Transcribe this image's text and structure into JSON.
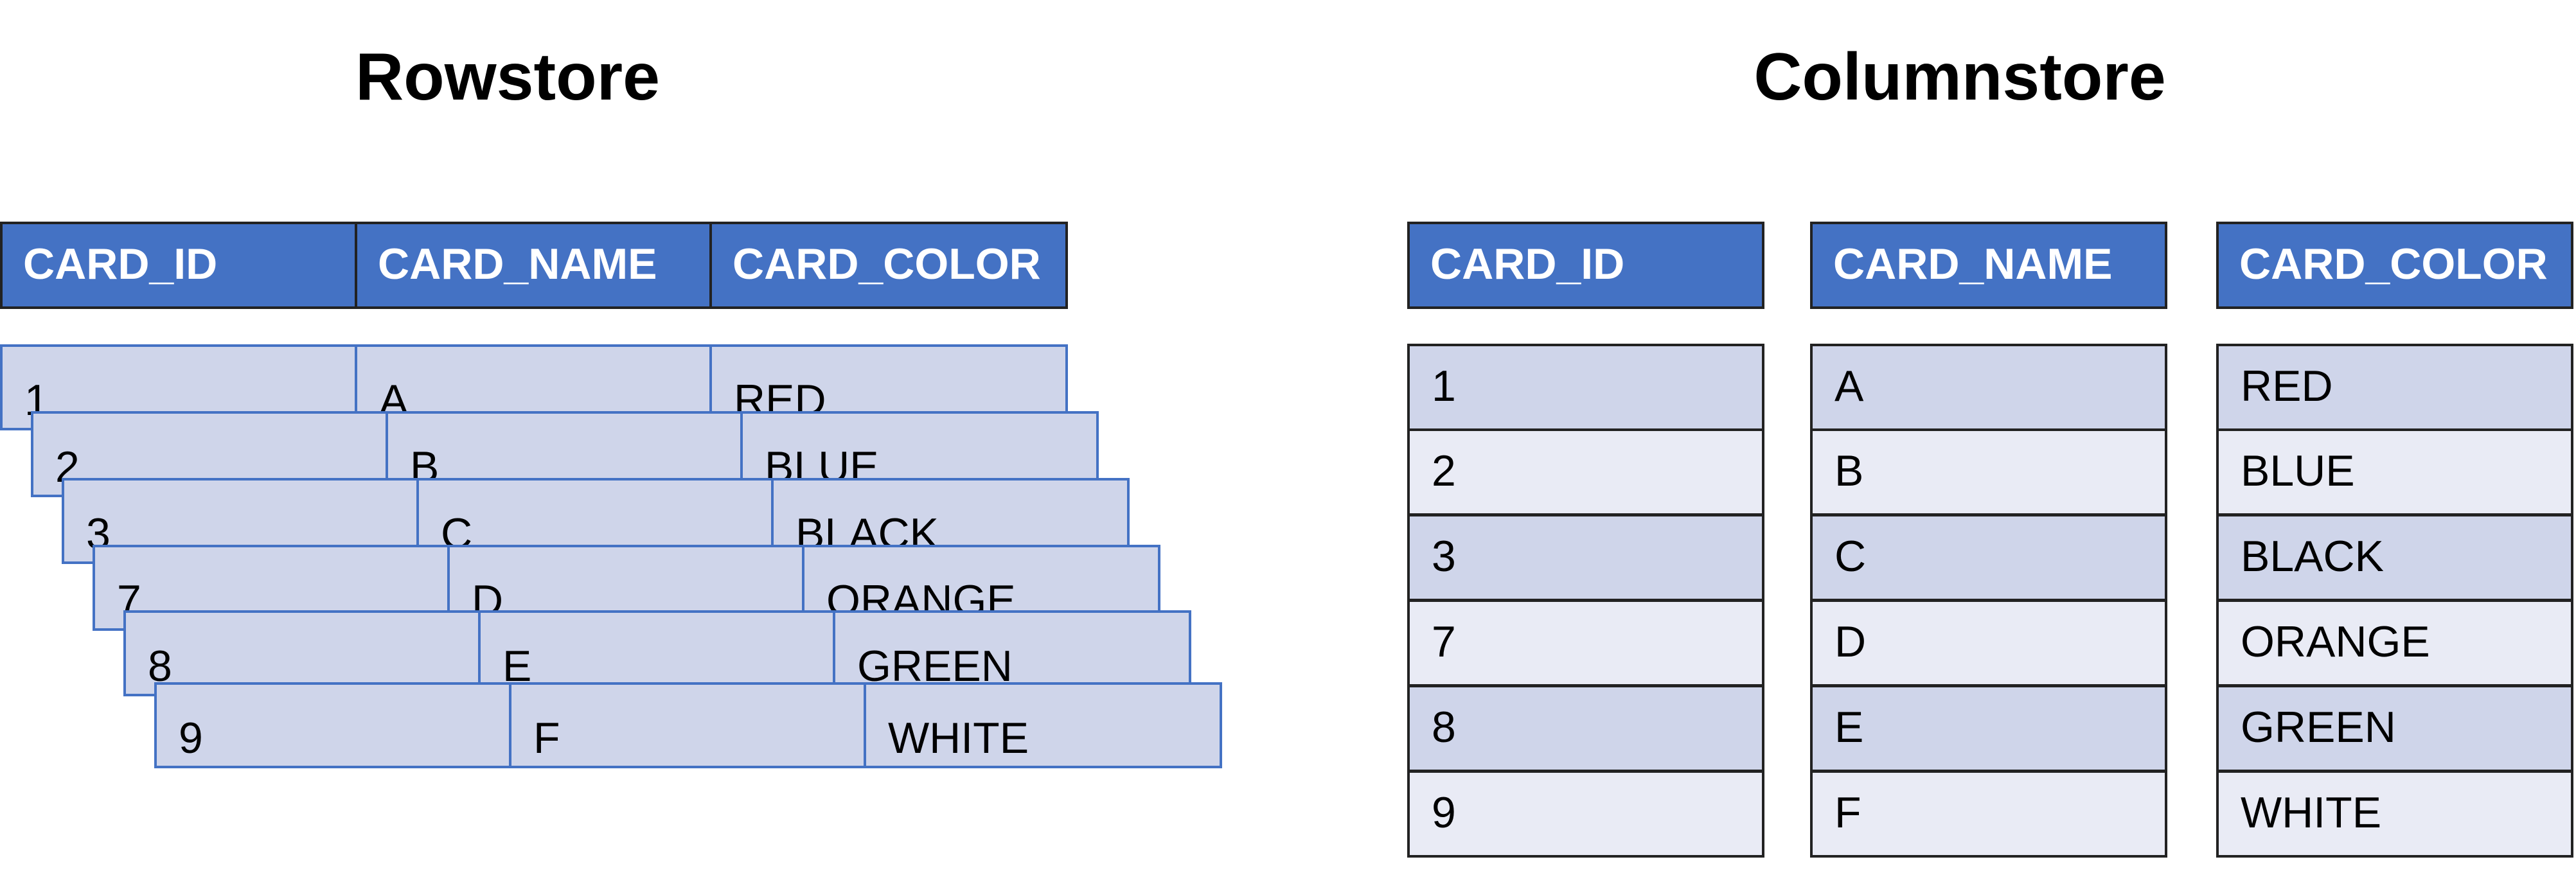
{
  "rowstore": {
    "title": "Rowstore",
    "headers": [
      "CARD_ID",
      "CARD_NAME",
      "CARD_COLOR"
    ],
    "rows": [
      [
        "1",
        "A",
        "RED"
      ],
      [
        "2",
        "B",
        "BLUE"
      ],
      [
        "3",
        "C",
        "BLACK"
      ],
      [
        "7",
        "D",
        "ORANGE"
      ],
      [
        "8",
        "E",
        "GREEN"
      ],
      [
        "9",
        "F",
        "WHITE"
      ]
    ]
  },
  "columnstore": {
    "title": "Columnstore",
    "columns": [
      {
        "header": "CARD_ID",
        "values": [
          "1",
          "2",
          "3",
          "7",
          "8",
          "9"
        ]
      },
      {
        "header": "CARD_NAME",
        "values": [
          "A",
          "B",
          "C",
          "D",
          "E",
          "F"
        ]
      },
      {
        "header": "CARD_COLOR",
        "values": [
          "RED",
          "BLUE",
          "BLACK",
          "ORANGE",
          "GREEN",
          "WHITE"
        ]
      }
    ]
  },
  "colors": {
    "header_fill": "#4472c4",
    "header_text": "#ffffff",
    "row_fill": "#cfd5ea",
    "row_fill_alt": "#e9ebf5",
    "row_border": "#4472c4",
    "dark_border": "#222222"
  }
}
